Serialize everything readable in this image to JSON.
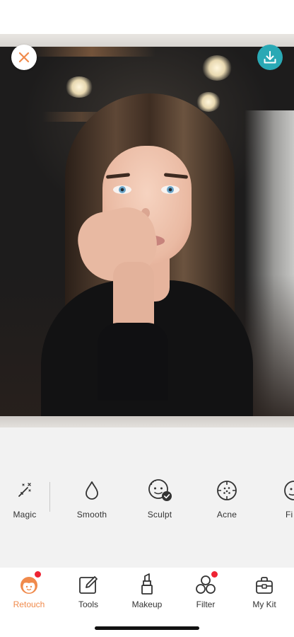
{
  "colors": {
    "accent": "#f08a4b",
    "download_bg": "#2aa9b5",
    "notification_dot": "#ee2333",
    "panel_bg": "#f2f2f2"
  },
  "header": {
    "close_icon": "close-x-icon",
    "download_icon": "download-icon"
  },
  "photo": {
    "subject": "portrait"
  },
  "tools": [
    {
      "label": "Magic",
      "icon": "magic-wand-icon"
    },
    {
      "label": "Smooth",
      "icon": "droplet-icon"
    },
    {
      "label": "Sculpt",
      "icon": "face-sculpt-icon"
    },
    {
      "label": "Acne",
      "icon": "acne-target-icon"
    },
    {
      "label": "Fi",
      "icon": "face-icon"
    }
  ],
  "tabs": [
    {
      "label": "Retouch",
      "icon": "retouch-face-icon",
      "active": true,
      "badge": true
    },
    {
      "label": "Tools",
      "icon": "edit-pencil-icon",
      "active": false,
      "badge": false
    },
    {
      "label": "Makeup",
      "icon": "lipstick-icon",
      "active": false,
      "badge": false
    },
    {
      "label": "Filter",
      "icon": "filter-circles-icon",
      "active": false,
      "badge": true
    },
    {
      "label": "My Kit",
      "icon": "kit-bag-icon",
      "active": false,
      "badge": false
    }
  ]
}
